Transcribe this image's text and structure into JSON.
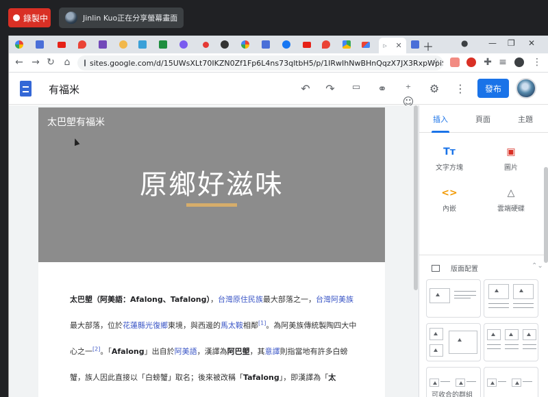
{
  "meet": {
    "record_label": "錄製中",
    "share_text": "Jinlin Kuo正在分享螢幕畫面"
  },
  "browser": {
    "url": "sites.google.com/d/15UWsXLt70IKZN0Zf1Fp6L4ns73qltbH5/p/1IRwIhNwBHnQqzX7JX3RxpWpiSEi..."
  },
  "sites": {
    "site_name": "有福米",
    "publish_label": "發布"
  },
  "page": {
    "hero_site_title": "太巴塱有福米",
    "hero_title": "原鄉好滋味",
    "body": {
      "t1": "太巴塱（阿美語：Afalong、Tafalong）",
      "t2": "，",
      "l1": "台灣原住民族",
      "t3": "最大部落之一，",
      "l2": "台灣阿美族",
      "t4": "最大部落，位於",
      "l3": "花蓮縣光復鄉",
      "t5": "東境，與西邊的",
      "l4": "馬太鞍",
      "t6": "相鄰",
      "s1": "[1]",
      "t7": "。為阿美族傳統製陶四大中心之一",
      "s2": "[2]",
      "t8": "。「",
      "b1": "Afalong",
      "t9": "」出自於",
      "l5": "阿美語",
      "t10": "，漢譯為",
      "b2": "阿巴塱",
      "t11": "，其",
      "l6": "意譯",
      "t12": "則指當地有許多白螃蟹，族人因此直接以「白螃蟹」取名；後來被改稱「",
      "b3": "Tafalong",
      "t13": "」，即漢譯為「",
      "b4": "太"
    }
  },
  "panel": {
    "tabs": [
      "插入",
      "頁面",
      "主題"
    ],
    "insert_items": [
      {
        "icon": "text-box-icon",
        "label": "文字方塊"
      },
      {
        "icon": "image-icon",
        "label": "圖片"
      },
      {
        "icon": "embed-icon",
        "label": "內嵌"
      },
      {
        "icon": "drive-icon",
        "label": "雲端硬碟"
      }
    ],
    "layouts_label": "版面配置",
    "footer_label": "可收合的群組"
  }
}
